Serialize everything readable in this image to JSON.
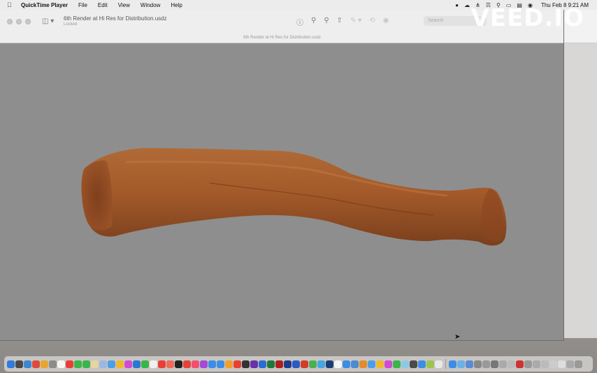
{
  "menubar": {
    "apple_icon": "apple-icon",
    "app_name": "QuickTime Player",
    "items": [
      "File",
      "Edit",
      "View",
      "Window",
      "Help"
    ],
    "clock": "Thu Feb 8  9:21 AM",
    "status_icons": [
      "record-icon",
      "creative-cloud-icon",
      "bluetooth-icon",
      "wifi-icon",
      "search-icon",
      "battery-icon",
      "control-center-icon",
      "siri-icon"
    ]
  },
  "watermark": "VEED.IO",
  "window": {
    "doc_title": "6th Render at Hi Res for Distribution.usdz",
    "doc_subtitle": "Locked",
    "center_title": "6th Render at Hi Res for Distribution.usdz",
    "search_placeholder": "Search",
    "toolbar_icons": [
      "info-icon",
      "zoom-out-icon",
      "zoom-in-icon",
      "share-icon",
      "markup-icon",
      "rotate-icon",
      "annotate-icon"
    ]
  },
  "viewer": {
    "object": "3d-bone-model",
    "background_color": "#8e8e8e",
    "object_color": "#a45a2a"
  },
  "dock": {
    "icon_colors": [
      "#2f7be0",
      "#4a4a4a",
      "#3d86d6",
      "#de4b3a",
      "#e6a62f",
      "#8c8c8c",
      "#f5f5f5",
      "#e94035",
      "#3ab54a",
      "#3ab54a",
      "#e6d5a0",
      "#9cb8e2",
      "#4c9ee8",
      "#f0b82e",
      "#d34bd0",
      "#2a77d4",
      "#3ab54a",
      "#f0f0f0",
      "#e94035",
      "#f06a5a",
      "#222",
      "#e94035",
      "#f05070",
      "#a24bd8",
      "#3b8ee6",
      "#3b8ee6",
      "#f0a02a",
      "#e94035",
      "#333",
      "#6b2fa8",
      "#2a6bd4",
      "#1c7a3a",
      "#b01e1e",
      "#1e3c8c",
      "#2a5bbf",
      "#d43b2a",
      "#4caf50",
      "#46a6e6",
      "#1c3f73",
      "#f5f5f5",
      "#3b8ee6",
      "#4a8bd4",
      "#e68a2a",
      "#4a9ee8",
      "#f0b82e",
      "#d34bd0",
      "#3ab54a",
      "#8cc9e8",
      "#4a4a4a",
      "#3b8ee6",
      "#9cc64a",
      "#e8e8e8",
      "#3b8ee6",
      "#6cb0e8",
      "#5a8bd4",
      "#888",
      "#999",
      "#777",
      "#aaa",
      "#bbb",
      "#c33",
      "#999",
      "#aaa",
      "#bbb",
      "#ccc",
      "#ddd",
      "#aaa",
      "#999"
    ]
  }
}
